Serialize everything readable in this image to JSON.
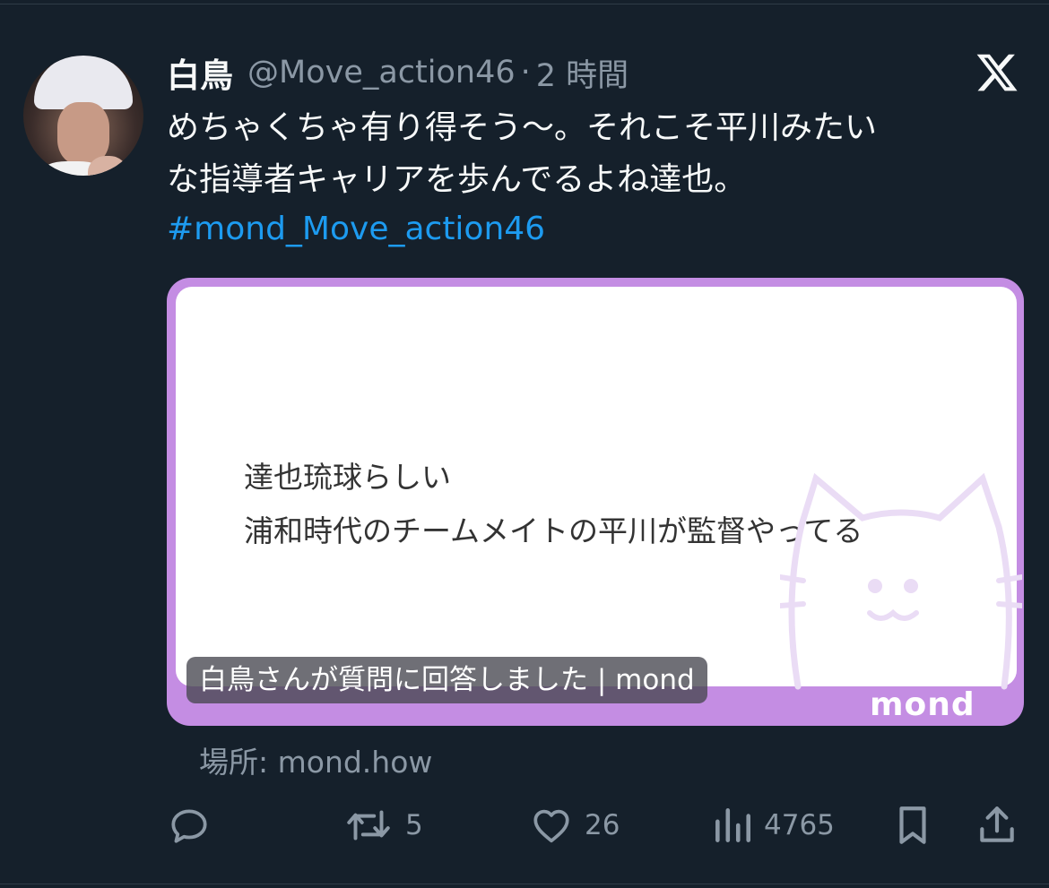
{
  "tweet": {
    "display_name": "白鳥",
    "handle": "@Move_action46",
    "separator": "·",
    "time": "2 時間",
    "text": "めちゃくちゃ有り得そう〜。それこそ平川みたい\nな指導者キャリアを歩んでるよね達也。",
    "hashtag": "#mond_Move_action46"
  },
  "card": {
    "line1": "達也琉球らしい",
    "line2": "浦和時代のチームメイトの平川が監督やってる",
    "caption": "白鳥さんが質問に回答しました | mond",
    "brand": "mond",
    "bg_color": "#c48de3"
  },
  "source": "場所: mond.how",
  "actions": {
    "reply_icon": "reply-icon",
    "retweet_icon": "retweet-icon",
    "retweet_count": "5",
    "like_icon": "heart-icon",
    "like_count": "26",
    "views_icon": "views-icon",
    "views_count": "4765",
    "bookmark_icon": "bookmark-icon",
    "share_icon": "share-icon"
  },
  "colors": {
    "background": "#15202b",
    "hashtag": "#1d9bf0",
    "muted": "#8b98a5"
  }
}
